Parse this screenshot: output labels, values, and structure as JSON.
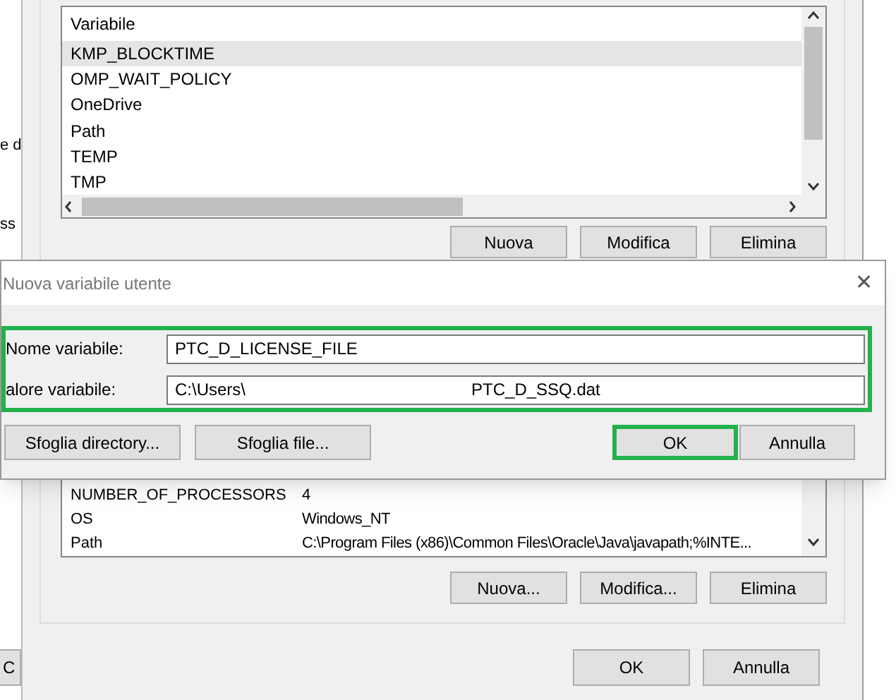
{
  "left_window": {
    "texts": [
      "e d",
      "ss"
    ],
    "button": "C"
  },
  "user_variables": {
    "column_header": "Variabile",
    "rows": [
      {
        "name": "KMP_BLOCKTIME",
        "selected": true
      },
      {
        "name": "OMP_WAIT_POLICY",
        "selected": false
      },
      {
        "name": "OneDrive",
        "selected": false
      },
      {
        "name": "Path",
        "selected": false
      },
      {
        "name": "TEMP",
        "selected": false
      },
      {
        "name": "TMP",
        "selected": false
      }
    ],
    "buttons": [
      "Nuova",
      "Modifica",
      "Elimina"
    ]
  },
  "system_variables": {
    "rows": [
      {
        "name": "NUMBER_OF_PROCESSORS",
        "value": "4"
      },
      {
        "name": "OS",
        "value": "Windows_NT"
      },
      {
        "name": "Path",
        "value": "C:\\Program Files (x86)\\Common Files\\Oracle\\Java\\javapath;%INTE..."
      }
    ],
    "buttons": [
      "Nuova...",
      "Modifica...",
      "Elimina"
    ]
  },
  "footer_buttons": [
    "OK",
    "Annulla"
  ],
  "dialog": {
    "title": "Nuova variabile utente",
    "close": "✕",
    "fields": [
      {
        "label": "Nome variabile:",
        "value_parts": [
          "PTC_D_LICENSE_FILE"
        ]
      },
      {
        "label": "alore variabile:",
        "value_parts": [
          "C:\\Users\\",
          "PTC_D_SSQ.dat"
        ]
      }
    ],
    "buttons": [
      {
        "label": "Sfoglia directory...",
        "highlighted": false
      },
      {
        "label": "Sfoglia file...",
        "highlighted": false
      },
      {
        "label": "OK",
        "highlighted": true
      },
      {
        "label": "Annulla",
        "highlighted": false
      }
    ]
  }
}
